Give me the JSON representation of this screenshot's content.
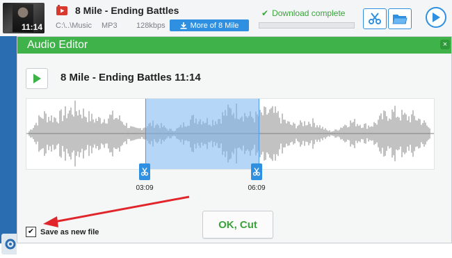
{
  "header": {
    "thumbnail_duration": "11:14",
    "title": "8 Mile - Ending Battles",
    "path": "C:\\..\\Music",
    "format": "MP3",
    "bitrate": "128kbps",
    "more_label": "More of 8 Mile",
    "status": "Download complete",
    "progress_fraction": 0.0
  },
  "editor": {
    "title": "Audio Editor",
    "track_title": "8 Mile - Ending Battles  11:14",
    "selection_start": "03:09",
    "selection_end": "06:09",
    "ok_label": "OK, Cut",
    "save_label": "Save as new file",
    "save_checked": true
  },
  "icons": {
    "youtube": "youtube-icon",
    "download": "download-icon",
    "check": "check-icon",
    "scissors": "scissors-icon",
    "folder": "folder-icon",
    "play": "play-icon",
    "close": "close-icon",
    "gear": "gear-icon"
  },
  "colors": {
    "accent_blue": "#2f8fe0",
    "header_green": "#3fb24a",
    "status_green": "#3aa33a",
    "arrow_red": "#e0262b"
  }
}
